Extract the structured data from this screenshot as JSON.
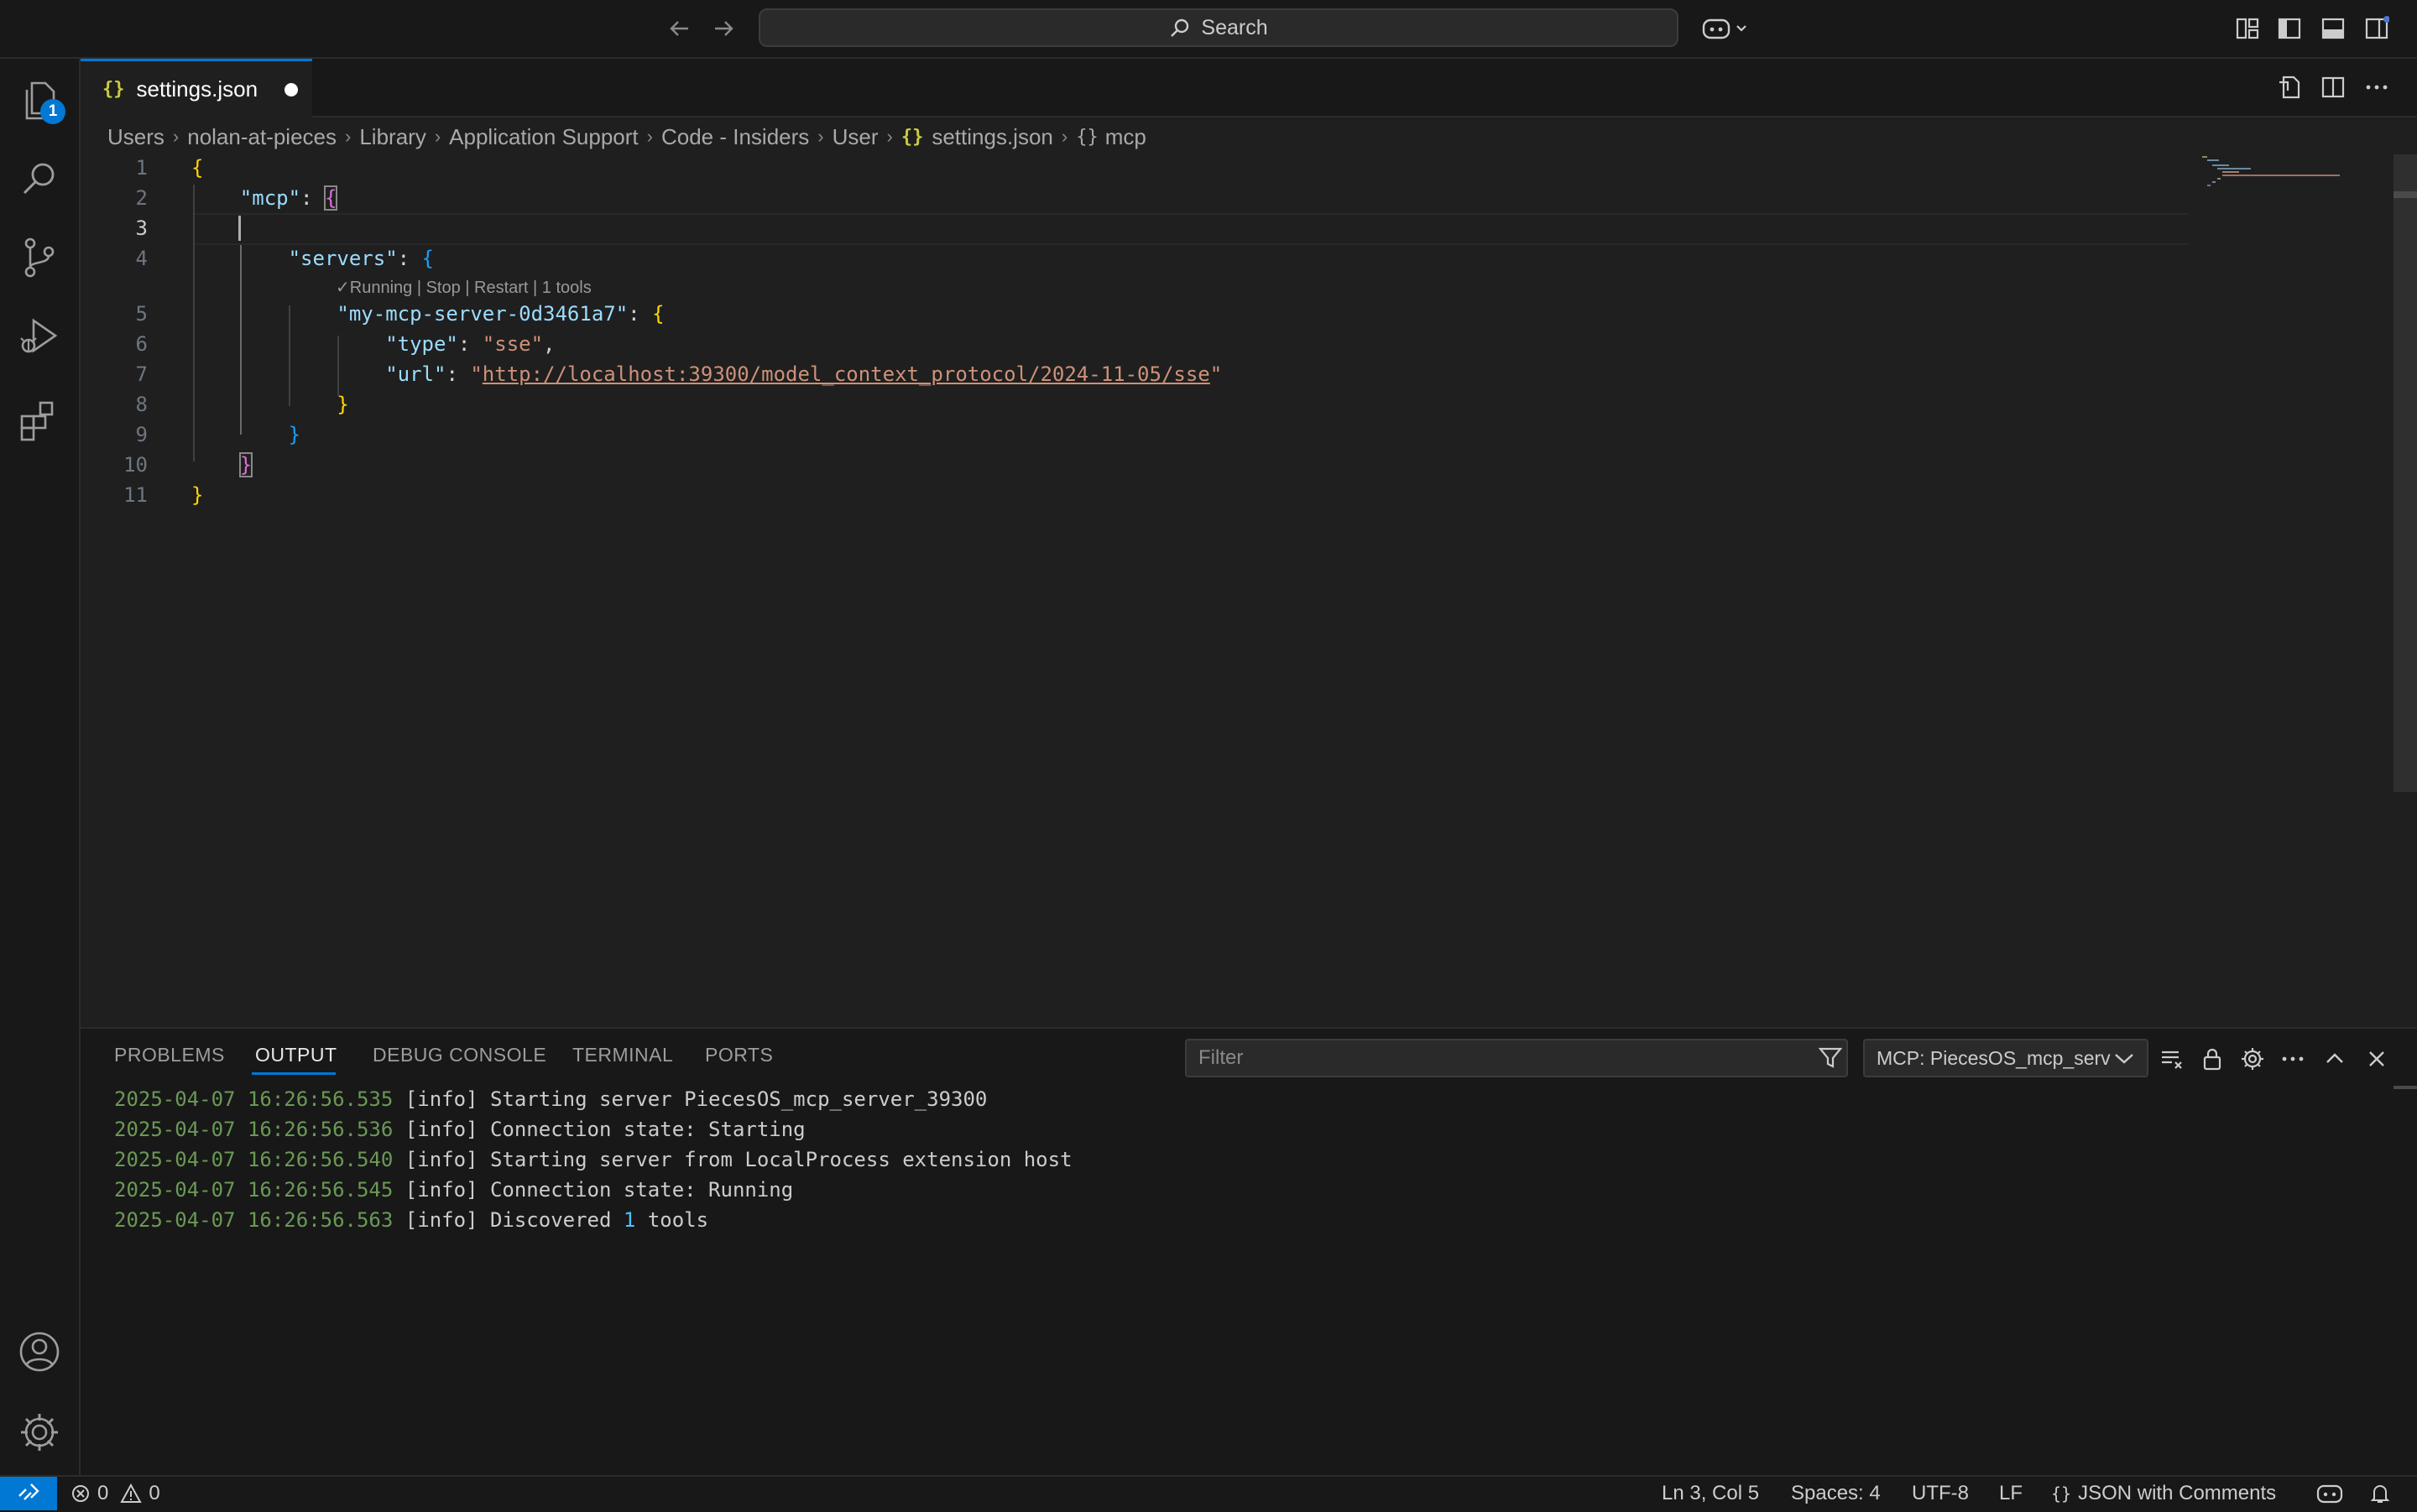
{
  "titlebar": {
    "search_label": "Search"
  },
  "activity": {
    "explorer_badge": "1"
  },
  "tab": {
    "icon": "{}",
    "label": "settings.json"
  },
  "breadcrumb": [
    "Users",
    "nolan-at-pieces",
    "Library",
    "Application Support",
    "Code - Insiders",
    "User",
    "settings.json",
    "mcp"
  ],
  "breadcrumb_icons": {
    "file": "{}",
    "symbol": "{}"
  },
  "editor": {
    "line_numbers": [
      "1",
      "2",
      "3",
      "4",
      "5",
      "6",
      "7",
      "8",
      "9",
      "10",
      "11"
    ],
    "codelens": "✓Running | Stop | Restart | 1 tools",
    "keys": {
      "mcp": "\"mcp\"",
      "servers": "\"servers\"",
      "server_name": "\"my-mcp-server-0d3461a7\"",
      "type": "\"type\"",
      "url": "\"url\""
    },
    "values": {
      "type": "\"sse\"",
      "url": "http://localhost:39300/model_context_protocol/2024-11-05/sse"
    }
  },
  "panel": {
    "tabs": [
      "PROBLEMS",
      "OUTPUT",
      "DEBUG CONSOLE",
      "TERMINAL",
      "PORTS"
    ],
    "active_tab": "OUTPUT",
    "filter_placeholder": "Filter",
    "channel": "MCP: PiecesOS_mcp_serv",
    "log": [
      {
        "ts": "2025-04-07 16:26:56.535",
        "level": "[info]",
        "msg": "Starting server PiecesOS_mcp_server_39300"
      },
      {
        "ts": "2025-04-07 16:26:56.536",
        "level": "[info]",
        "msg": "Connection state: Starting"
      },
      {
        "ts": "2025-04-07 16:26:56.540",
        "level": "[info]",
        "msg": "Starting server from LocalProcess extension host"
      },
      {
        "ts": "2025-04-07 16:26:56.545",
        "level": "[info]",
        "msg": "Connection state: Running"
      },
      {
        "ts": "2025-04-07 16:26:56.563",
        "level": "[info]",
        "msg_pre": "Discovered",
        "msg_num": "1",
        "msg_post": "tools"
      }
    ]
  },
  "statusbar": {
    "errors": "0",
    "warnings": "0",
    "position": "Ln 3, Col 5",
    "spaces": "Spaces: 4",
    "encoding": "UTF-8",
    "eol": "LF",
    "language_icon": "{}",
    "language": "JSON with Comments"
  },
  "colors": {
    "accent": "#0078d4",
    "background": "#1f1f1f",
    "chrome": "#181818"
  }
}
